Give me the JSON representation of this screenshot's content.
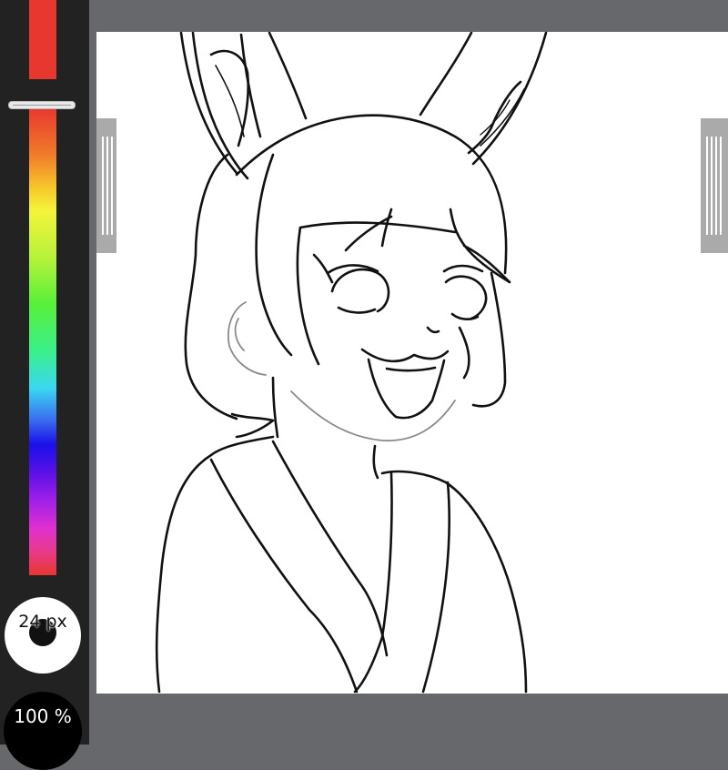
{
  "toolbar": {
    "current_color": "#e8372e",
    "brush_size_label": "24 px",
    "opacity_label": "100 %",
    "hue_slider_position": 0.0
  },
  "canvas": {
    "background": "#ffffff",
    "stroke_color": "#111111"
  },
  "icons": {
    "scroll_handle_left": "vertical-grip-icon",
    "scroll_handle_right": "vertical-grip-icon"
  }
}
